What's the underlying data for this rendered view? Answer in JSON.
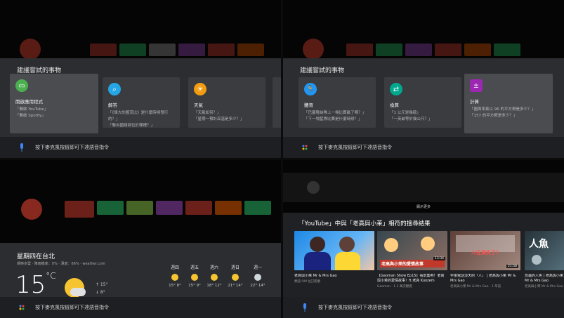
{
  "hint": "按下麥克風按鈕即可下達語音指令",
  "panel1": {
    "title": "建議嘗試的事物",
    "cards": [
      {
        "title": "開啟應用程式",
        "lines": [
          "「開啟 YouTube」",
          "「開啟 Spotify」"
        ],
        "icon": "app-icon",
        "color": "#4caf50"
      },
      {
        "title": "解答",
        "lines": [
          "「《偉大的蓋茨比》是什麼時候發行",
          "的？」",
          "「聯合國總部位於哪裡？」"
        ],
        "icon": "search-icon",
        "color": "#26a5e4"
      },
      {
        "title": "天氣",
        "lines": [
          "「天氣如何？」",
          "「星期一預計高溫是多少？」"
        ],
        "icon": "sun-icon",
        "color": "#f39c12"
      }
    ]
  },
  "panel2": {
    "title": "建議嘗試的事物",
    "cards": [
      {
        "title": "體育",
        "lines": [
          "「巴塞隆納隊上一場比賽贏了嗎？」",
          "「下一場藍隊比賽是什麼時候？」"
        ],
        "icon": "run-icon",
        "color": "#2196f3"
      },
      {
        "title": "換算",
        "lines": [
          "「1 公斤是幾磅」",
          "「一英畝等於幾公尺？」"
        ],
        "icon": "convert-icon",
        "color": "#00a88e"
      },
      {
        "title": "計算",
        "lines": [
          "「圓周率乘以 96 的平方根是多少？」",
          "「157 的平方根是多少？」"
        ],
        "icon": "calc-icon",
        "color": "#9c27b0"
      }
    ]
  },
  "weather": {
    "title": "星期四在台北",
    "sub": "晴時多雲 · 降雨機率：0% · 濕度：66% · weather.com",
    "temp": "15",
    "unit": "°C",
    "high": "↑ 15°",
    "low": "↓ 8°",
    "forecast": [
      {
        "day": "週四",
        "temp": "15° 8°"
      },
      {
        "day": "週五",
        "temp": "15° 9°"
      },
      {
        "day": "週六",
        "temp": "18° 12°"
      },
      {
        "day": "週日",
        "temp": "21° 14°"
      },
      {
        "day": "週一",
        "temp": "22° 14°"
      }
    ]
  },
  "youtube": {
    "more": "顯示更多",
    "title": "「YouTube」中與「老高與小茉」相符的搜尋結果",
    "videos": [
      {
        "title": "老高與小茉 Mr & Mrs Gao",
        "meta": "頻道 OM 位訂閱者",
        "colorA": "#1e88e5",
        "colorB": "#f5c6a5",
        "overlay": "",
        "dur": ""
      },
      {
        "title": "【Gaoman Show Ep15】看影集吧！老高與小茉的愛情故事！ft.老高 Kuozem",
        "meta": "Gaoman · 1.2 萬次觀看",
        "colorA": "#c0392b",
        "colorB": "#f1c40f",
        "overlay": "老高與小茉的愛情故事",
        "dur": "13:34"
      },
      {
        "title": "宇宙電話淡天的『人』 | 老高與小茉 Mr & Mrs Gao",
        "meta": "老高與小茉 Mr & Mrs Gao · 1 年前",
        "colorA": "#6d4c41",
        "colorB": "#d7ccc8",
        "overlay": "人在演失了？",
        "dur": "21:58"
      },
      {
        "title": "恐蟲的人魚 | 老高與小茉 Mr & Mrs Gao",
        "meta": "老高與小茉 Mr & Mrs Gao",
        "colorA": "#263238",
        "colorB": "#90a4ae",
        "overlay": "人魚",
        "dur": ""
      }
    ]
  }
}
